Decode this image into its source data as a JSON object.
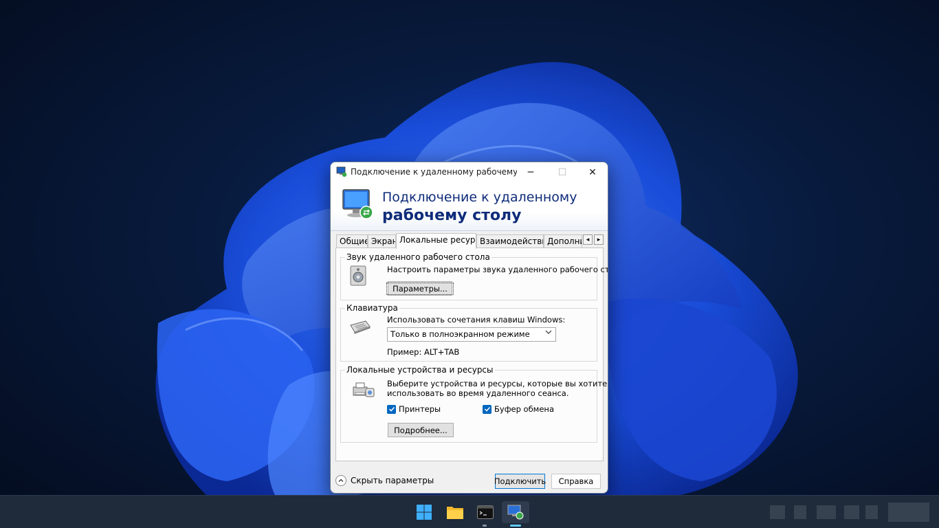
{
  "window": {
    "title": "Подключение к удаленному рабочему сто...",
    "minimize_glyph": "─",
    "maximize_glyph": "☐",
    "close_glyph": "✕",
    "banner_line1": "Подключение к удаленному",
    "banner_line2": "рабочему столу"
  },
  "tabs": [
    {
      "label": "Общие",
      "active": false
    },
    {
      "label": "Экран",
      "active": false
    },
    {
      "label": "Локальные ресурсы",
      "active": true
    },
    {
      "label": "Взаимодействие",
      "active": false
    },
    {
      "label": "Дополнительно",
      "active": false
    }
  ],
  "tab_scroll": {
    "left": "◂",
    "right": "▸"
  },
  "audio": {
    "legend": "Звук удаленного рабочего стола",
    "description": "Настроить параметры звука удаленного рабочего стола.",
    "button_label": "Параметры..."
  },
  "keyboard": {
    "legend": "Клавиатура",
    "description": "Использовать сочетания клавиш Windows:",
    "selected_option": "Только в полноэкранном режиме",
    "example": "Пример: ALT+TAB"
  },
  "local_devices": {
    "legend": "Локальные устройства и ресурсы",
    "description_line1": "Выберите устройства и ресурсы, которые вы хотите",
    "description_line2": "использовать во время удаленного сеанса.",
    "printers_label": "Принтеры",
    "printers_checked": true,
    "clipboard_label": "Буфер обмена",
    "clipboard_checked": true,
    "more_button_label": "Подробнее..."
  },
  "footer": {
    "hide_options_label": "Скрыть параметры",
    "connect_label": "Подключить",
    "help_label": "Справка"
  },
  "taskbar": {
    "icons": [
      "windows-start-icon",
      "file-explorer-icon",
      "terminal-icon",
      "remote-desktop-icon"
    ],
    "accent_color": "#60cdff"
  },
  "colors": {
    "banner_text": "#0f2c7a",
    "check_accent": "#0067c0",
    "focus_border": "#0078d4"
  }
}
